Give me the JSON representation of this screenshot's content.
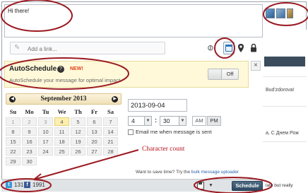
{
  "composer": {
    "message": "Hi there!"
  },
  "toolbar": {
    "link_placeholder": "Add a link..."
  },
  "autoschedule": {
    "title": "AutoSchedule",
    "badge": "NEW!",
    "description": "AutoSchedule your message for optimal impact.",
    "toggle_label": "Off",
    "close": "×"
  },
  "calendar": {
    "month": "September 2013",
    "weekdays": [
      "Su",
      "Mo",
      "Tu",
      "We",
      "Th",
      "Fr",
      "Sa"
    ],
    "weeks": [
      [
        "1",
        "2",
        "3",
        "4",
        "5",
        "6",
        "7"
      ],
      [
        "8",
        "9",
        "10",
        "11",
        "12",
        "13",
        "14"
      ],
      [
        "15",
        "16",
        "17",
        "18",
        "19",
        "20",
        "21"
      ],
      [
        "22",
        "23",
        "24",
        "25",
        "26",
        "27",
        "28"
      ],
      [
        "29",
        "30",
        "",
        "",
        "",
        "",
        ""
      ]
    ],
    "selected_day": "4"
  },
  "schedule": {
    "date": "2013-09-04",
    "hour": "4",
    "minute": "30",
    "am": "AM",
    "pm": "PM",
    "email_label": "Email me when message is sent"
  },
  "annotation": {
    "label": "Character count"
  },
  "bulk": {
    "prefix": "Want to save time? Try the",
    "link": "bulk message uploader"
  },
  "bottom": {
    "twitter_count": "131",
    "facebook_count": "1991",
    "schedule_button": "Schedule"
  },
  "background": {
    "row1": "Bud'zdorova!",
    "row2": "a, С Днем Рож",
    "row3": "late but really"
  },
  "colors": {
    "annotation": "#b4141c",
    "twitter": "#3a9ad9",
    "facebook": "#3b5998"
  }
}
